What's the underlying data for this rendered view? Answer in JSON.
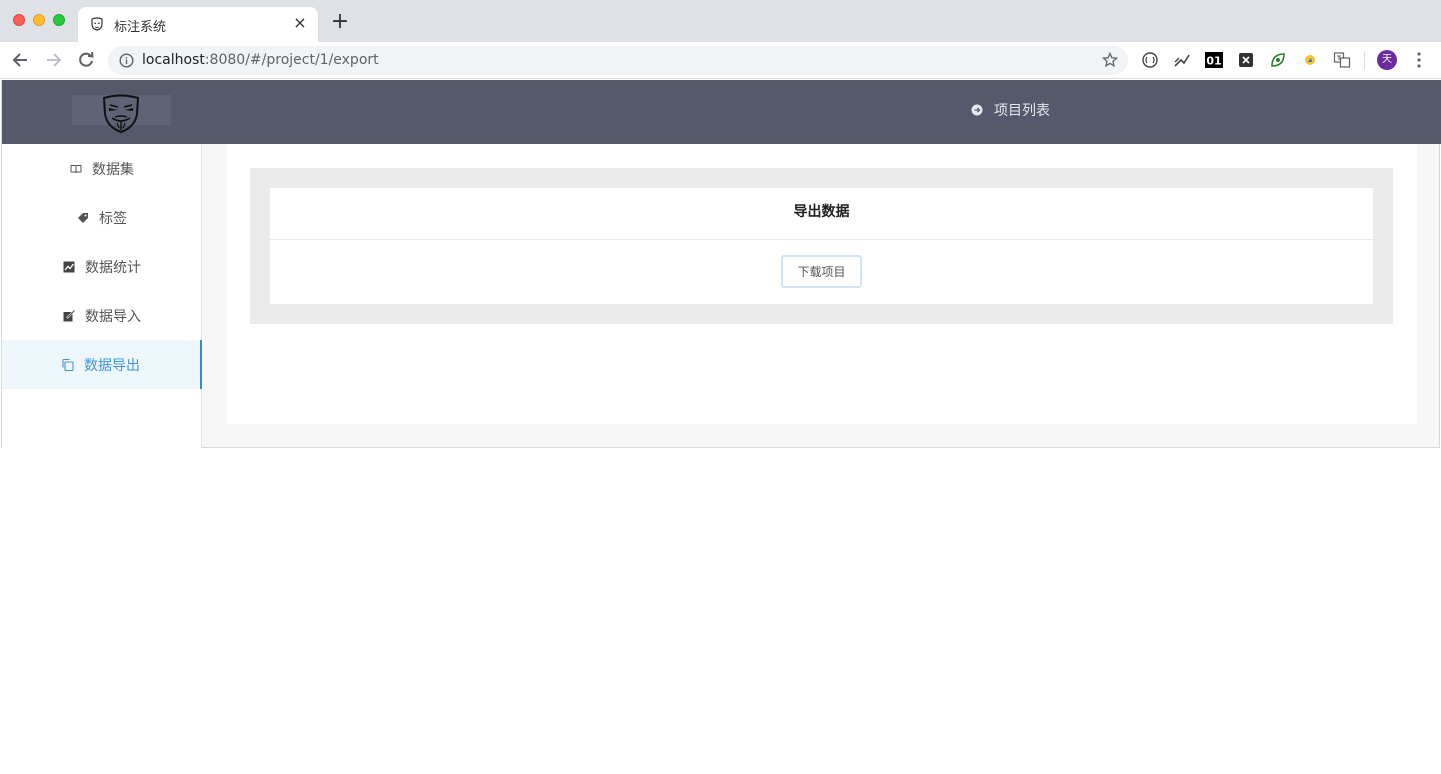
{
  "browser": {
    "tab_title": "标注系统",
    "tab_close": "×",
    "new_tab": "+",
    "url_host": "localhost",
    "url_path": ":8080/#/project/1/export",
    "profile_initial": "天"
  },
  "app": {
    "header": {
      "nav_label": "项目列表",
      "nav_icon": "circle-arrow-icon"
    },
    "sidebar": {
      "items": [
        {
          "label": "数据集",
          "icon": "book-icon",
          "active": false
        },
        {
          "label": "标签",
          "icon": "tag-icon",
          "active": false
        },
        {
          "label": "数据统计",
          "icon": "chart-icon",
          "active": false
        },
        {
          "label": "数据导入",
          "icon": "edit-icon",
          "active": false
        },
        {
          "label": "数据导出",
          "icon": "copy-icon",
          "active": true
        }
      ]
    },
    "main": {
      "card_title": "导出数据",
      "download_button": "下载项目"
    },
    "colors": {
      "header_bg": "#545a6b",
      "active_accent": "#2d8cd8",
      "active_bg": "#eef7fc"
    }
  }
}
